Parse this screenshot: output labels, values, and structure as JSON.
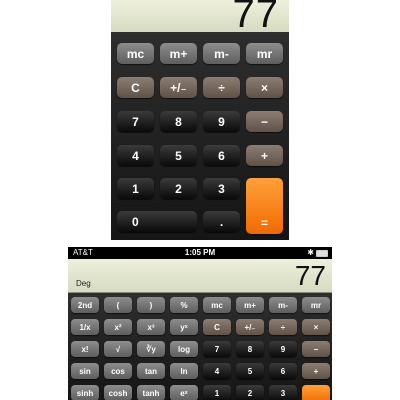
{
  "portrait": {
    "display": "77",
    "keys": {
      "mc": "mc",
      "mplus": "m+",
      "mminus": "m-",
      "mr": "mr",
      "clear": "C",
      "sign": "+/₋",
      "divide": "÷",
      "multiply": "×",
      "d7": "7",
      "d8": "8",
      "d9": "9",
      "minus": "−",
      "d4": "4",
      "d5": "5",
      "d6": "6",
      "plus": "+",
      "d1": "1",
      "d2": "2",
      "d3": "3",
      "d0": "0",
      "dot": ".",
      "equals": "="
    }
  },
  "landscape": {
    "status": {
      "carrier": "AT&T",
      "time": "1:05 PM",
      "bluetooth": "✱"
    },
    "display": {
      "mode": "Deg",
      "value": "77"
    },
    "keys": {
      "second": "2nd",
      "lparen": "(",
      "rparen": ")",
      "percent": "%",
      "mc": "mc",
      "mplus": "m+",
      "mminus": "m-",
      "mr": "mr",
      "reciprocal": "1/x",
      "square": "x²",
      "cube": "x³",
      "power": "yˣ",
      "clear": "C",
      "sign": "+/₋",
      "divide": "÷",
      "multiply": "×",
      "factorial": "x!",
      "sqrt": "√",
      "yroot": "∛y",
      "log": "log",
      "d7": "7",
      "d8": "8",
      "d9": "9",
      "minus": "−",
      "sin": "sin",
      "cos": "cos",
      "tan": "tan",
      "ln": "ln",
      "d4": "4",
      "d5": "5",
      "d6": "6",
      "plus": "+",
      "sinh": "sinh",
      "cosh": "cosh",
      "tanh": "tanh",
      "exp": "eˣ",
      "d1": "1",
      "d2": "2",
      "d3": "3"
    }
  }
}
